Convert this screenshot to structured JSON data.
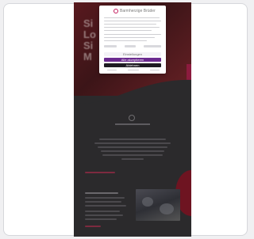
{
  "preview": {
    "hero_heading_lines": [
      "Si",
      "Lo",
      "Si",
      "M"
    ],
    "modal": {
      "brand": "Barmherzige Brüder",
      "button_settings": "Einstellungen",
      "button_accept": "Alle akzeptieren",
      "button_reject": "Ablehnen"
    }
  },
  "colors": {
    "hero_bg": "#3a0d13",
    "accent": "#8c1b3e",
    "accept_button": "#6b2a8f",
    "dark_button": "#1d1b22"
  }
}
